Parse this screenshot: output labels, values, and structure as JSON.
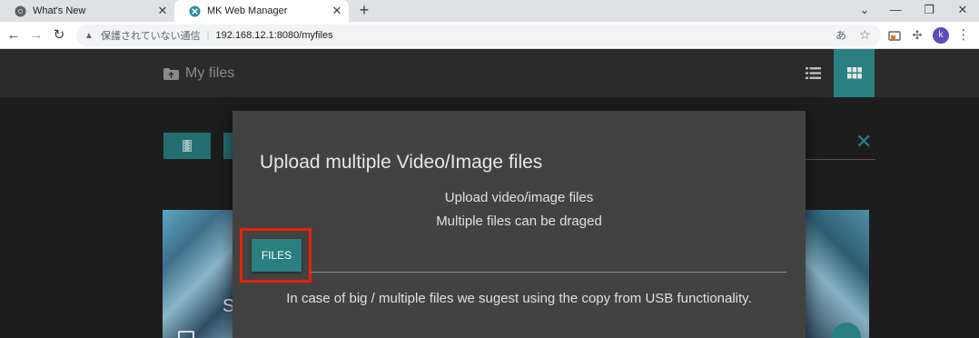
{
  "browser": {
    "tabs": [
      {
        "title": "What's New",
        "favicon": "chrome-icon",
        "active": false
      },
      {
        "title": "MK Web Manager",
        "favicon": "app-favicon",
        "active": true
      }
    ],
    "close_glyph": "✕",
    "new_tab_glyph": "+",
    "window_controls": {
      "dropdown": "⌄",
      "minimize": "—",
      "restore": "❐",
      "close": "✕"
    },
    "nav": {
      "back": "←",
      "forward": "→",
      "reload": "↻"
    },
    "address_bar": {
      "warning_glyph": "▲",
      "insecure_label": "保護されていない通信",
      "separator": "|",
      "url": "192.168.12.1:8080/myfiles"
    },
    "toolbar_glyphs": {
      "translate": "あ",
      "bookmark": "☆",
      "extensions": "✣",
      "menu": "⋮"
    },
    "profile_initial": "k",
    "accent_profile": "#5f4bbf"
  },
  "app": {
    "title": "My files",
    "accent": "#2a7f80",
    "close_glyph": "✕",
    "thumb_letter": "S"
  },
  "modal": {
    "title": "Upload multiple Video/Image files",
    "line1": "Upload video/image files",
    "line2": "Multiple files can be draged",
    "files_button": "FILES",
    "note": "In case of big / multiple files we sugest using the copy from USB functionality.",
    "highlight_color": "#e8210c"
  }
}
